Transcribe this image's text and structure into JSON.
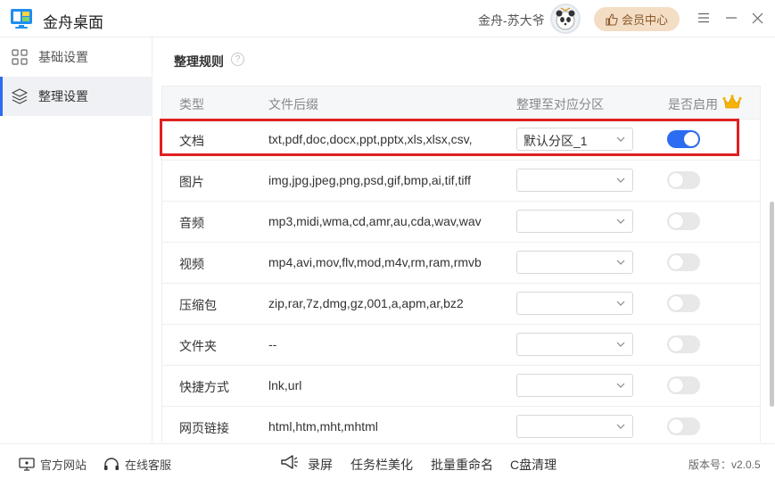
{
  "app": {
    "title": "金舟桌面",
    "user_name": "金舟-苏大爷",
    "vip_label": "会员中心"
  },
  "sidebar": {
    "items": [
      {
        "label": "基础设置",
        "icon": "grid-icon",
        "active": false
      },
      {
        "label": "整理设置",
        "icon": "layers-icon",
        "active": true
      }
    ]
  },
  "section": {
    "title": "整理规则",
    "help": "?"
  },
  "table": {
    "headers": {
      "type": "类型",
      "ext": "文件后缀",
      "zone": "整理至对应分区",
      "enabled": "是否启用"
    },
    "rows": [
      {
        "type": "文档",
        "ext": "txt,pdf,doc,docx,ppt,pptx,xls,xlsx,csv,",
        "zone": "默认分区_1",
        "enabled": true
      },
      {
        "type": "图片",
        "ext": "img,jpg,jpeg,png,psd,gif,bmp,ai,tif,tiff",
        "zone": "",
        "enabled": false
      },
      {
        "type": "音频",
        "ext": "mp3,midi,wma,cd,amr,au,cda,wav,wave",
        "zone": "",
        "enabled": false
      },
      {
        "type": "视频",
        "ext": "mp4,avi,mov,flv,mod,m4v,rm,ram,rmvb",
        "zone": "",
        "enabled": false
      },
      {
        "type": "压缩包",
        "ext": "zip,rar,7z,dmg,gz,001,a,apm,ar,bz2",
        "zone": "",
        "enabled": false
      },
      {
        "type": "文件夹",
        "ext": "--",
        "zone": "",
        "enabled": false
      },
      {
        "type": "快捷方式",
        "ext": "lnk,url",
        "zone": "",
        "enabled": false
      },
      {
        "type": "网页链接",
        "ext": "html,htm,mht,mhtml",
        "zone": "",
        "enabled": false
      }
    ]
  },
  "footer": {
    "website": "官方网站",
    "support": "在线客服",
    "tools": [
      "录屏",
      "任务栏美化",
      "批量重命名",
      "C盘清理"
    ],
    "version": "版本号：v2.0.5"
  },
  "colors": {
    "accent": "#2b6cf3",
    "highlight": "#e02020",
    "vip_bg": "#f3ddc4"
  }
}
